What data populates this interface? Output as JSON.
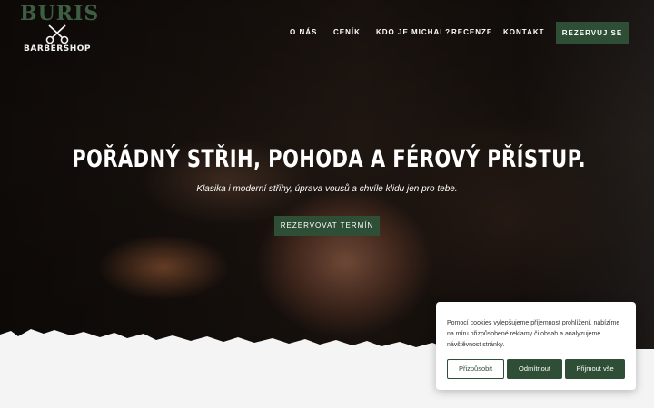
{
  "brand": {
    "name": "BURIS",
    "sub": "BARBERSHOP"
  },
  "nav": {
    "items": [
      "O NÁS",
      "CENÍK",
      "KDO JE MICHAL?",
      "RECENZE",
      "KONTAKT"
    ],
    "cta": "REZERVUJ SE"
  },
  "hero": {
    "headline": "POŘÁDNÝ STŘIH, POHODA A FÉROVÝ PŘÍSTUP.",
    "subline": "Klasika i moderní střihy, úprava vousů a chvíle klidu jen pro tebe.",
    "cta": "REZERVOVAT TERMÍN"
  },
  "cookie": {
    "text": "Pomocí cookies vylepšujeme příjemnost prohlížení, nabízíme na míru přizpůsobené reklamy či obsah a analyzujeme návštěvnost stránky.",
    "customize": "Přizpůsobit",
    "reject": "Odmítnout",
    "accept": "Přijmout vše"
  },
  "colors": {
    "accent": "#2f4e36",
    "logo": "#3e5e43",
    "hero_text": "#ffffff"
  },
  "icons": {
    "logo_mark": "scissors-icon"
  }
}
